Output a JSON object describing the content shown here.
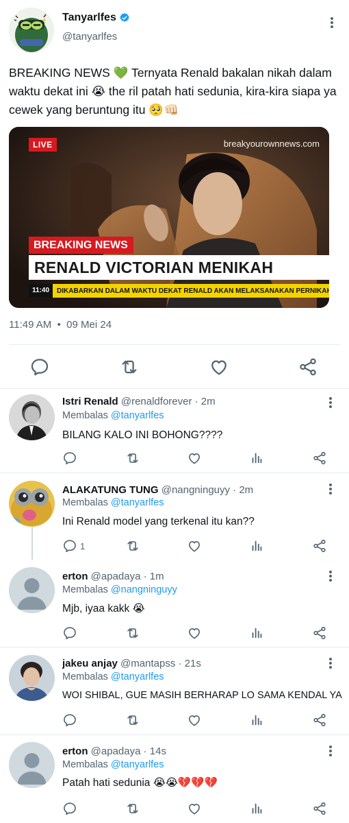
{
  "main_tweet": {
    "author_name": "Tanyarlfes",
    "author_handle": "@tanyarlfes",
    "text": "BREAKING NEWS 💚 Ternyata Renald bakalan nikah dalam waktu dekat ini 😭 the ril patah hati sedunia, kira-kira siapa ya cewek yang beruntung itu 🥺👊🏻",
    "timestamp": "11:49 AM  •  09 Mei 24",
    "news_card": {
      "live": "LIVE",
      "site": "breakyourownnews.com",
      "breaking": "BREAKING NEWS",
      "headline": "RENALD VICTORIAN MENIKAH",
      "ticker_time": "11:40",
      "ticker_text": "DIKABARKAN DALAM WAKTU DEKAT RENALD AKAN MELAKSANAKAN PERNIKAHAN"
    }
  },
  "replies": [
    {
      "name": "Istri Renald",
      "meta": " @renaldforever · 2m",
      "replying_prefix": "Membalas ",
      "replying_to": "@tanyarlfes",
      "text": "BILANG KALO INI BOHONG????",
      "reply_count": ""
    },
    {
      "name": "ALAKATUNG TUNG",
      "meta": " @nangninguyy · 2m",
      "replying_prefix": "Membalas ",
      "replying_to": "@tanyarlfes",
      "text": "Ini Renald model yang terkenal itu kan??",
      "reply_count": "1"
    },
    {
      "name": "erton",
      "meta": " @apadaya · 1m",
      "replying_prefix": "Membalas ",
      "replying_to": "@nangninguyy",
      "text": "Mjb, iyaa kakk 😭",
      "reply_count": ""
    },
    {
      "name": "jakeu anjay",
      "meta": " @mantapss · 21s",
      "replying_prefix": "Membalas ",
      "replying_to": "@tanyarlfes",
      "text": "WOI SHIBAL, GUE MASIH BERHARAP LO SAMA KENDAL YA",
      "reply_count": ""
    },
    {
      "name": "erton",
      "meta": " @apadaya · 14s",
      "replying_prefix": "Membalas ",
      "replying_to": "@tanyarlfes",
      "text": "Patah hati sedunia 😭😭💔💔💔",
      "reply_count": ""
    }
  ],
  "colors": {
    "accent": "#1d9bf0",
    "text_primary": "#0f1419",
    "text_secondary": "#536471",
    "breaking_red": "#d71920",
    "ticker_yellow": "#f3d300"
  },
  "icons": {
    "reply": "reply-icon",
    "retweet": "retweet-icon",
    "like": "heart-icon",
    "views": "views-icon",
    "share": "share-icon",
    "more": "more-vertical-icon",
    "verified": "verified-badge-icon"
  }
}
